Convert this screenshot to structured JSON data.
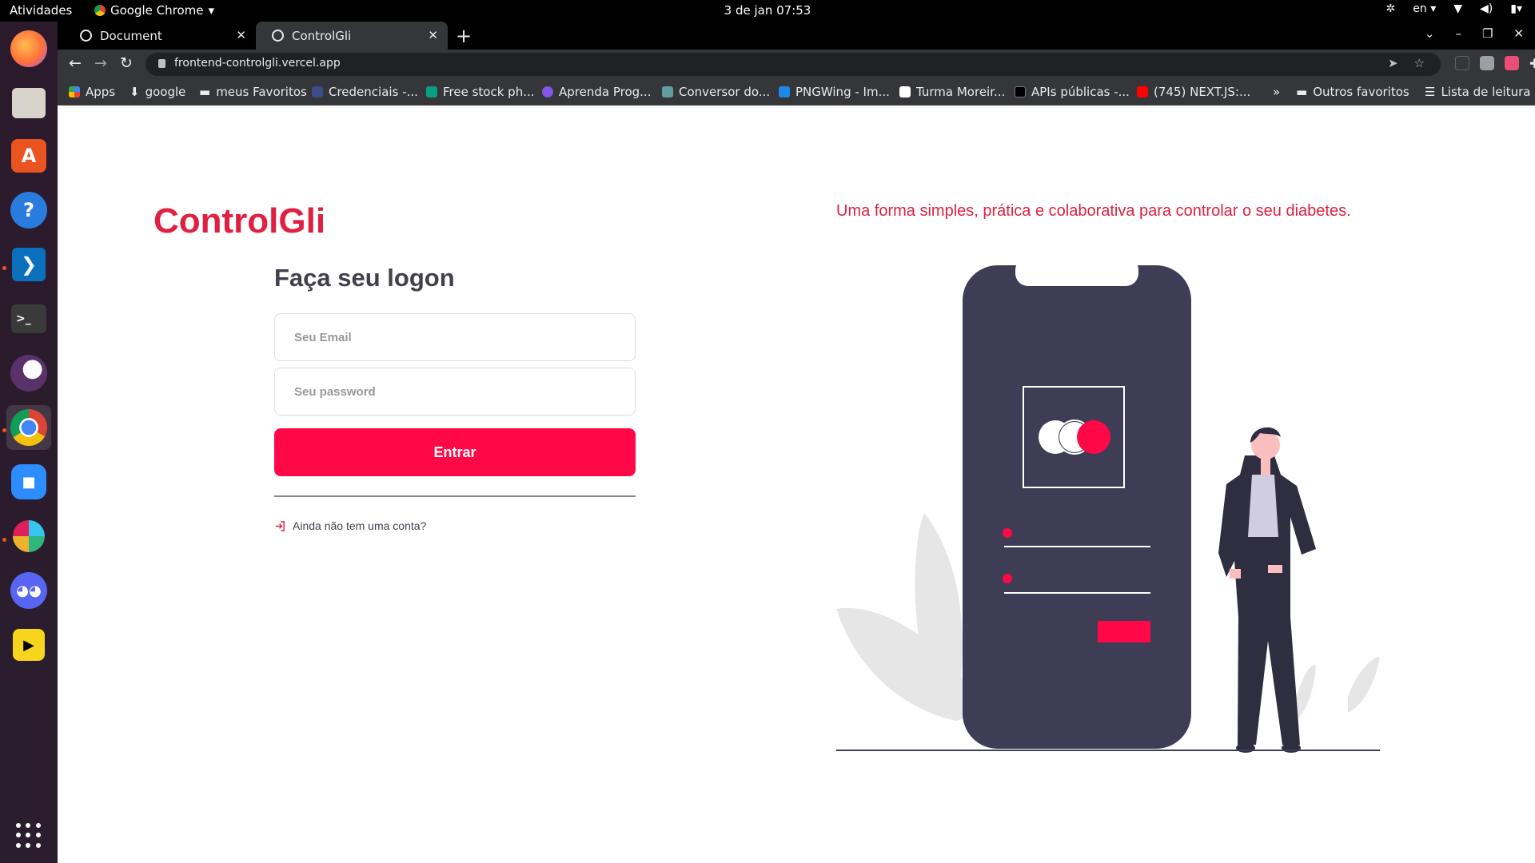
{
  "topbar": {
    "activities": "Atividades",
    "app_name": "Google Chrome",
    "clock": "3 de jan  07:53",
    "language": "en"
  },
  "dock": {
    "items": [
      "firefox-icon",
      "files-icon",
      "software-icon",
      "help-icon",
      "vscode-icon",
      "terminal-icon",
      "tor-icon",
      "chrome-icon",
      "zoom-icon",
      "slack-icon",
      "discord-icon",
      "kolourpaint-icon"
    ]
  },
  "chrome": {
    "tabs": [
      {
        "title": "Document"
      },
      {
        "title": "ControlGli"
      }
    ],
    "url": "frontend-controlgli.vercel.app",
    "bookmarks": [
      {
        "label": "Apps",
        "color": "#4285f4"
      },
      {
        "label": "google",
        "color": "#e8eaed"
      },
      {
        "label": "meus Favoritos",
        "color": "#bdc1c6"
      },
      {
        "label": "Credenciais -...",
        "color": "#8ab4f8"
      },
      {
        "label": "Free stock ph...",
        "color": "#05a081"
      },
      {
        "label": "Aprenda Prog...",
        "color": "#8257e5"
      },
      {
        "label": "Conversor do...",
        "color": "#5f9ea0"
      },
      {
        "label": "PNGWing - Im...",
        "color": "#1e88e5"
      },
      {
        "label": "Turma Moreir...",
        "color": "#ffffff"
      },
      {
        "label": "APIs públicas -...",
        "color": "#000000"
      },
      {
        "label": "(745) NEXT.JS:...",
        "color": "#ff0000"
      }
    ],
    "other_bookmarks": "Outros favoritos",
    "reading_list": "Lista de leitura",
    "overflow": "»"
  },
  "page": {
    "brand": "ControlGli",
    "tagline": "Uma forma simples, prática e colaborativa para controlar o seu diabetes.",
    "form_title": "Faça seu logon",
    "email_placeholder": "Seu Email",
    "password_placeholder": "Seu password",
    "submit_label": "Entrar",
    "signup_link": "Ainda não tem uma conta?"
  },
  "colors": {
    "accent": "#e02041",
    "button": "#ff0847",
    "phone": "#3f3d56"
  }
}
